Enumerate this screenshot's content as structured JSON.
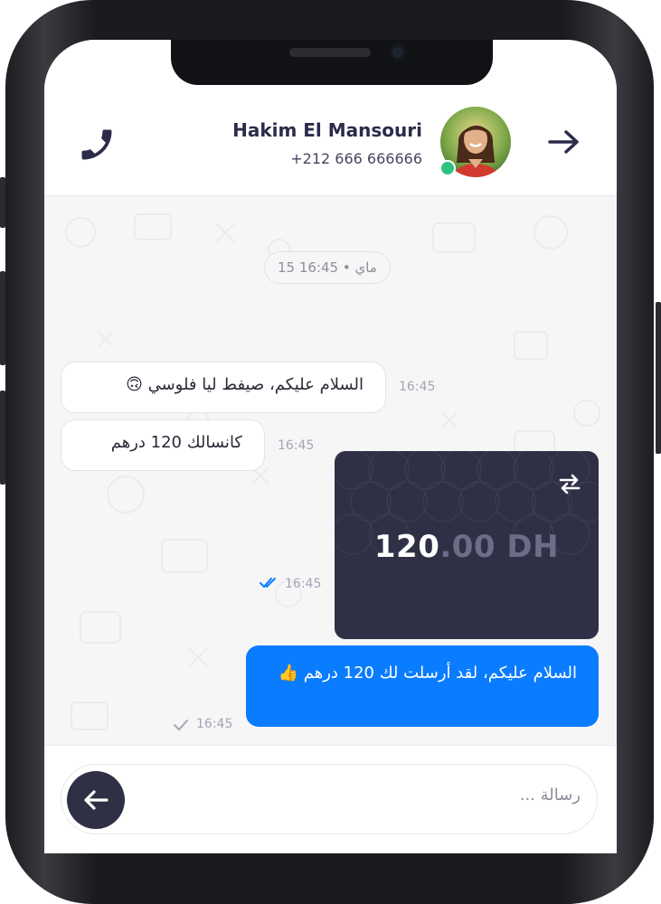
{
  "header": {
    "contact_name": "Hakim El Mansouri",
    "contact_phone": "+212 666 666666",
    "online_status_color": "#2ec27e"
  },
  "chat": {
    "date_label": "15 ماي • 16:45",
    "messages": [
      {
        "direction": "incoming",
        "text": "السلام عليكم، صيفط ليا فلوسي 🙃",
        "time": "16:45"
      },
      {
        "direction": "incoming",
        "text": "كانسالك 120 درهم",
        "time": "16:45"
      },
      {
        "direction": "outgoing",
        "type": "money-transfer",
        "amount_main": "120",
        "amount_decimals": ".00 DH",
        "time": "16:45",
        "status": "read"
      },
      {
        "direction": "outgoing",
        "text": "السلام عليكم، لقد أرسلت لك 120 درهم 👍",
        "time": "16:45",
        "status": "sent"
      }
    ]
  },
  "composer": {
    "placeholder": "رسالة ..."
  },
  "colors": {
    "accent_blue": "#0a7cff",
    "dark_navy": "#2f2f45"
  },
  "icons": {
    "call": "phone-icon",
    "back": "arrow-right-icon",
    "transfer": "transfer-arrows-icon",
    "send": "arrow-left-icon",
    "read_receipt": "double-check-icon",
    "sent_receipt": "single-check-icon"
  }
}
